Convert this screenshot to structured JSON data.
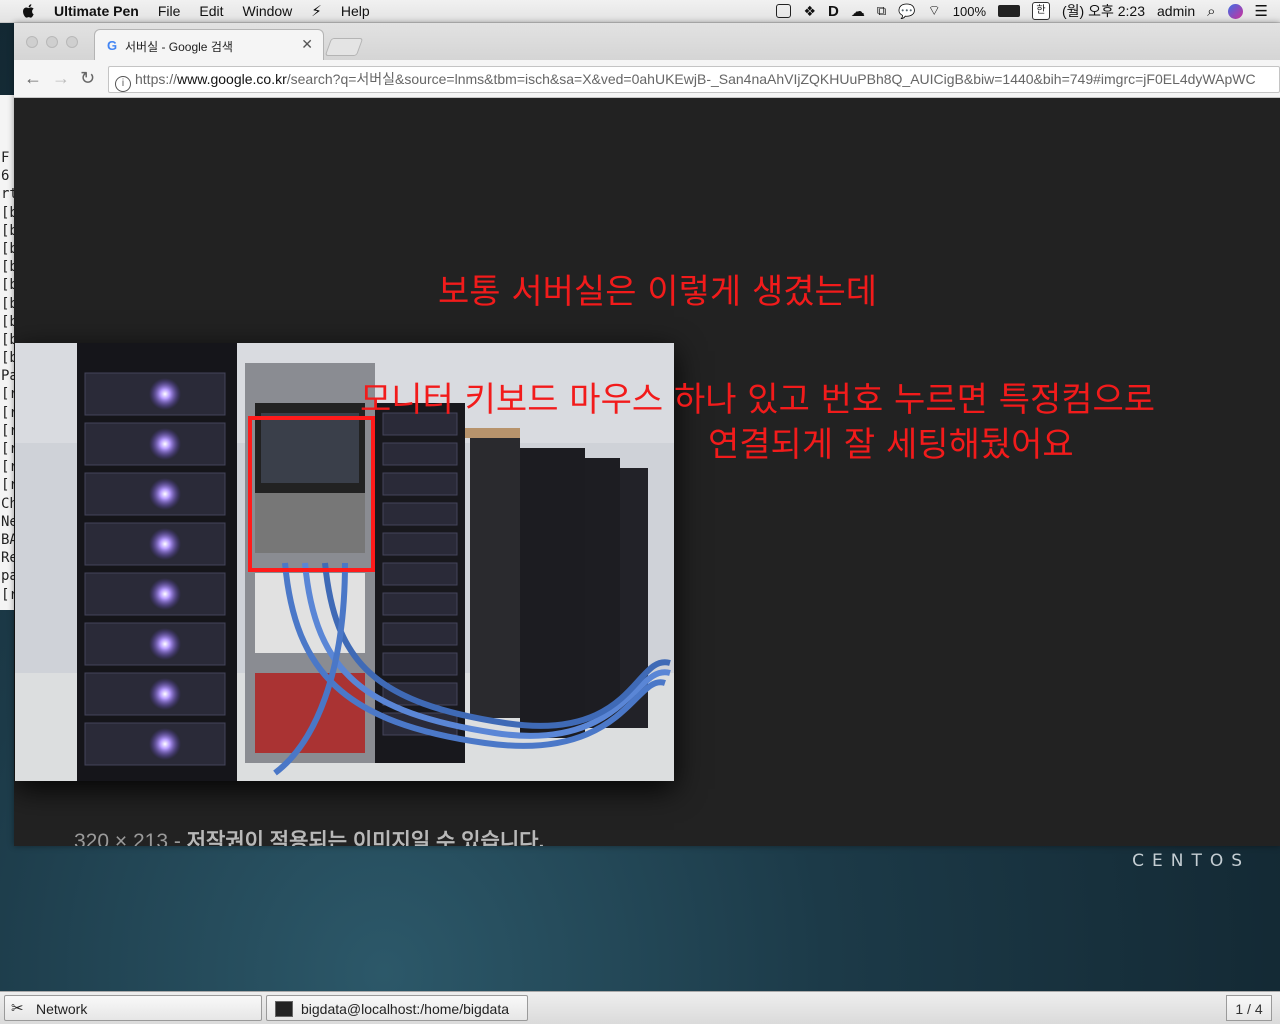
{
  "menubar": {
    "app_name": "Ultimate Pen",
    "items": [
      "File",
      "Edit",
      "Window",
      "Help"
    ],
    "battery": "100%",
    "ime": "한",
    "clock": "(월) 오후 2:23",
    "user": "admin"
  },
  "browser": {
    "tab_title": "서버실 - Google 검색",
    "url_proto": "https://",
    "url_host": "www.google.co.kr",
    "url_rest": "/search?q=서버실&source=lnms&tbm=isch&sa=X&ved=0ahUKEwjB-_San4naAhVIjZQKHUuPBh8Q_AUICigB&biw=1440&bih=749#imgrc=jF0EL4dyWApWC"
  },
  "annotations": {
    "line1": "보통 서버실은 이렇게 생겼는데",
    "line2": "모니터 키보드 마우스 하나 있고 번호 누르면 특정컴으로",
    "line3": "연결되게 잘 세팅해뒀어요"
  },
  "image_caption": {
    "size": "320 × 213",
    "separator": " - ",
    "notice": "저작권이 적용되는 이미지일 수 있습니다."
  },
  "terminal_lines": [
    "F",
    "6",
    "rt",
    "[b",
    "[b",
    "[b",
    "[b",
    "[b",
    "[b",
    "[b",
    "[b",
    "[b",
    "Pa",
    "[r",
    "[r",
    "[r",
    "[r",
    "[r",
    "[r",
    "Ch",
    "Ne",
    "BA",
    "Re",
    "pa",
    "[r"
  ],
  "desktop": {
    "brand": "CENTOS"
  },
  "taskbar": {
    "network_label": "Network",
    "terminal_label": "bigdata@localhost:/home/bigdata",
    "workspace": "1 / 4"
  },
  "colors": {
    "annotation_red": "#f21b1b",
    "page_bg": "#222222"
  }
}
